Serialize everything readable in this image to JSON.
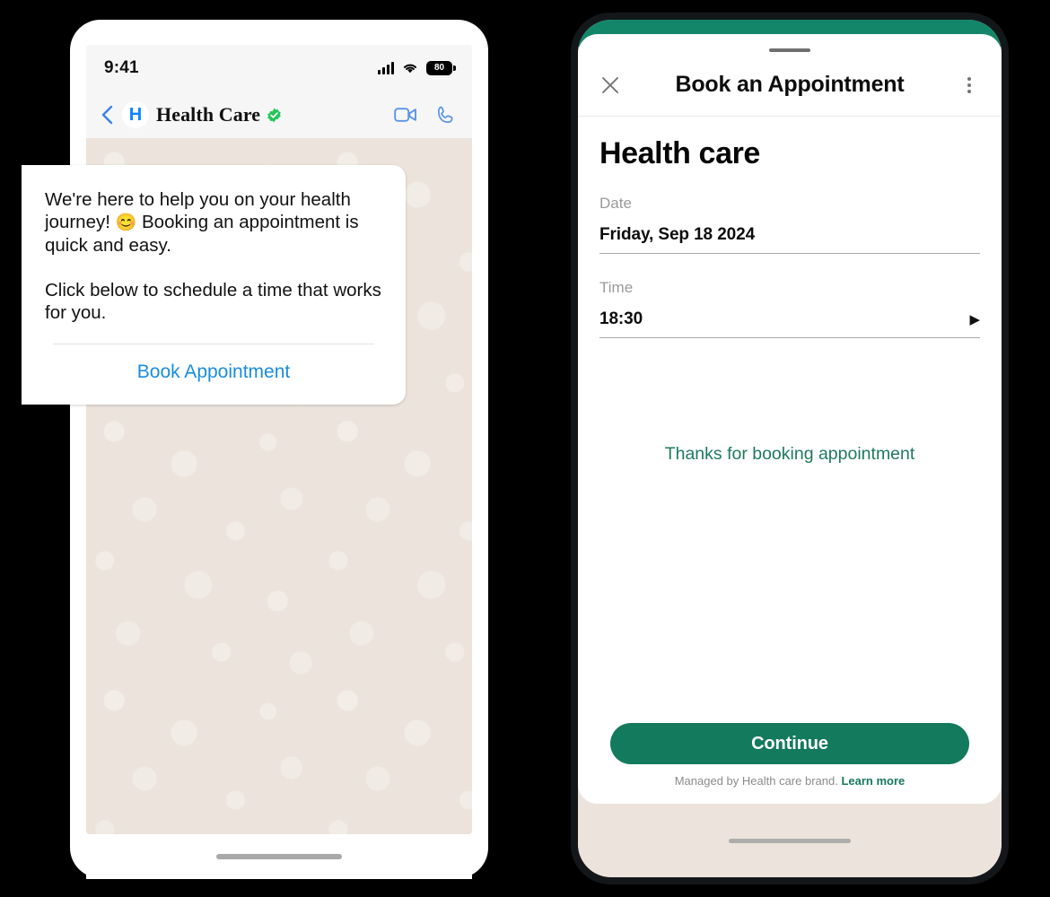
{
  "background_color": "#000000",
  "left_phone": {
    "status_bar": {
      "time": "9:41",
      "signal_icon": "cellular-bars-icon",
      "wifi_icon": "wifi-icon",
      "battery_level": "80",
      "battery_icon": "battery-icon"
    },
    "chat_header": {
      "back_icon": "back-chevron-icon",
      "avatar_letter": "H",
      "contact_name": "Health Care",
      "verified_icon": "verified-badge-icon",
      "video_call_icon": "video-camera-icon",
      "voice_call_icon": "phone-handset-icon",
      "accent_color": "#1a8ce0"
    },
    "message_card": {
      "paragraph_1_a": "We're here to help you on your health journey! ",
      "emoji": "😊",
      "paragraph_1_b": "  Booking an appointment is quick and easy.",
      "paragraph_2": "Click below to schedule a time that works for you.",
      "cta_label": "Book Appointment",
      "cta_color": "#1a8ce0"
    },
    "home_indicator": "home-indicator"
  },
  "right_phone": {
    "status_strip_color": "#13866a",
    "sheet": {
      "drag_handle": "drag-handle",
      "close_icon": "close-x-icon",
      "title": "Book an Appointment",
      "overflow_icon": "kebab-menu-icon",
      "form": {
        "heading": "Health care",
        "fields": [
          {
            "label": "Date",
            "value": "Friday, Sep 18 2024",
            "chevron": false
          },
          {
            "label": "Time",
            "value": "18:30",
            "chevron": true
          }
        ],
        "chevron_icon": "caret-right-icon",
        "status_message": "Thanks for booking appointment",
        "status_color": "#1e7a5e"
      },
      "footer": {
        "continue_label": "Continue",
        "continue_color": "#137a5d",
        "managed_prefix": "Managed by Health care brand.",
        "learn_more_label": "Learn more",
        "learn_more_color": "#17785d"
      }
    },
    "home_indicator": "home-indicator"
  }
}
